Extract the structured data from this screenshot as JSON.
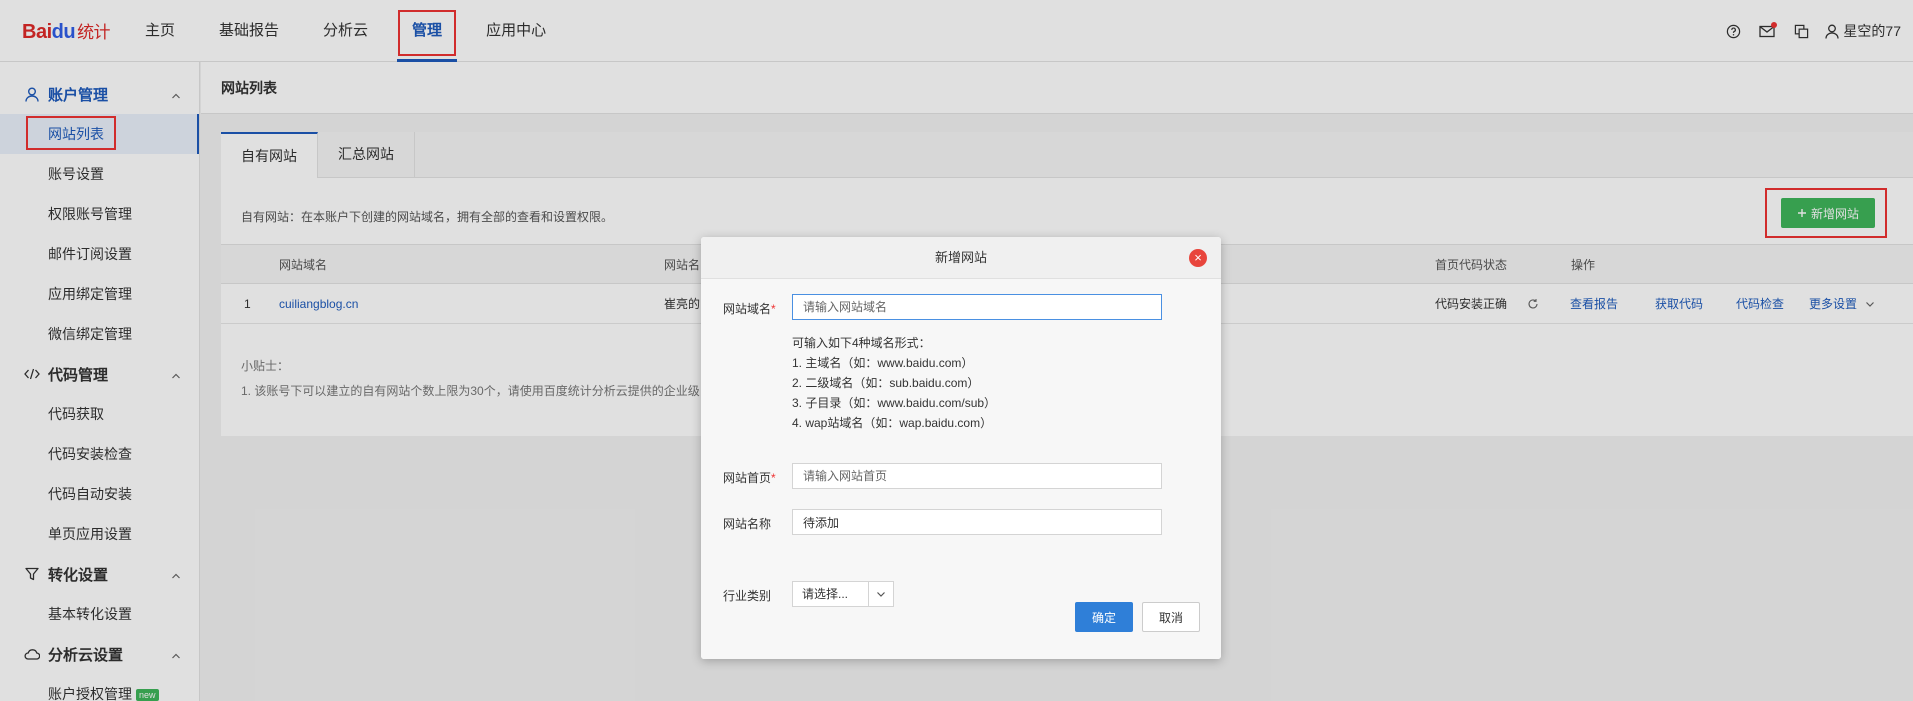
{
  "logo": {
    "bai": "Bai",
    "du": "du",
    "tongji": "统计"
  },
  "nav": {
    "items": [
      {
        "label": "主页",
        "active": false
      },
      {
        "label": "基础报告",
        "active": false
      },
      {
        "label": "分析云",
        "active": false
      },
      {
        "label": "管理",
        "active": true
      },
      {
        "label": "应用中心",
        "active": false
      }
    ]
  },
  "user": {
    "name": "星空的77"
  },
  "sidebar": {
    "sections": [
      {
        "title": "账户管理",
        "icon": "user-icon",
        "items": [
          "网站列表",
          "账号设置",
          "权限账号管理",
          "邮件订阅设置",
          "应用绑定管理",
          "微信绑定管理"
        ]
      },
      {
        "title": "代码管理",
        "icon": "code-icon",
        "items": [
          "代码获取",
          "代码安装检查",
          "代码自动安装",
          "单页应用设置"
        ]
      },
      {
        "title": "转化设置",
        "icon": "filter-icon",
        "items": [
          "基本转化设置"
        ]
      },
      {
        "title": "分析云设置",
        "icon": "cloud-icon",
        "items": [
          "账户授权管理"
        ]
      }
    ],
    "new_badge": "new"
  },
  "page": {
    "title": "网站列表"
  },
  "tabs": [
    {
      "label": "自有网站",
      "active": true
    },
    {
      "label": "汇总网站",
      "active": false
    }
  ],
  "description": "自有网站：在本账户下创建的网站域名，拥有全部的查看和设置权限。",
  "add_button": "新增网站",
  "table": {
    "headers": {
      "domain": "网站域名",
      "name": "网站名",
      "status": "首页代码状态",
      "ops": "操作"
    },
    "rows": [
      {
        "index": "1",
        "domain": "cuiliangblog.cn",
        "name": "崔亮的",
        "status": "代码安装正确",
        "view": "查看报告",
        "code": "获取代码",
        "check": "代码检查",
        "more": "更多设置"
      }
    ]
  },
  "tips": {
    "title": "小贴士：",
    "line1": "1. 该账号下可以建立的自有网站个数上限为30个，请使用百度统计分析云提供的企业级"
  },
  "dialog": {
    "title": "新增网站",
    "domain_label": "网站域名",
    "domain_placeholder": "请输入网站域名",
    "hint_title": "可输入如下4种域名形式：",
    "hints": [
      "1. 主域名（如：www.baidu.com）",
      "2. 二级域名（如：sub.baidu.com）",
      "3. 子目录（如：www.baidu.com/sub）",
      "4. wap站域名（如：wap.baidu.com）"
    ],
    "homepage_label": "网站首页",
    "homepage_placeholder": "请输入网站首页",
    "sitename_label": "网站名称",
    "sitename_value": "待添加",
    "industry_label": "行业类别",
    "industry_value": "请选择...",
    "ok": "确定",
    "cancel": "取消"
  },
  "colors": {
    "accent": "#1e5bbc",
    "add_button": "#3fb55b",
    "confirm": "#2f7fd8",
    "highlight": "#e33333"
  }
}
